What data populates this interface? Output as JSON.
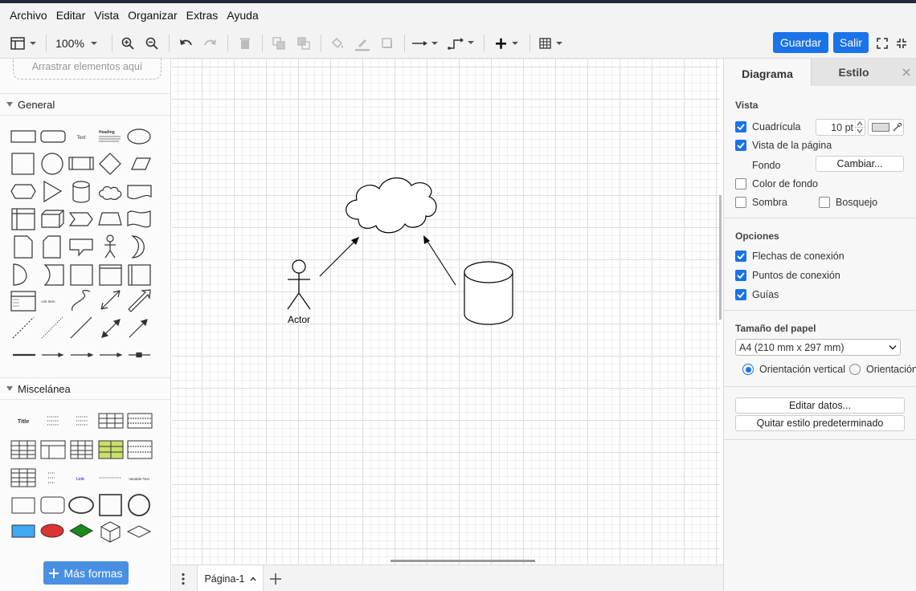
{
  "menu": [
    "Archivo",
    "Editar",
    "Vista",
    "Organizar",
    "Extras",
    "Ayuda"
  ],
  "toolbar": {
    "zoom": "100%",
    "save_label": "Guardar",
    "exit_label": "Salir"
  },
  "sidebar": {
    "drop_zone": "Arrastrar elementos aquí",
    "section_general": "General",
    "section_misc": "Miscelánea",
    "more_shapes": "Más formas",
    "shape_labels": {
      "text": "Text",
      "heading": "Heading",
      "title": "Title",
      "list_item": "List Item",
      "link": "Link",
      "variable": "Variable Text"
    }
  },
  "canvas": {
    "actor_label": "Actor"
  },
  "pages": {
    "current": "Página-1"
  },
  "panel": {
    "tab_diagram": "Diagrama",
    "tab_style": "Estilo",
    "view_title": "Vista",
    "grid_label": "Cuadrícula",
    "grid_size": "10 pt",
    "page_view_label": "Vista de la página",
    "background_label": "Fondo",
    "change_label": "Cambiar...",
    "bg_color_label": "Color de fondo",
    "shadow_label": "Sombra",
    "sketch_label": "Bosquejo",
    "options_title": "Opciones",
    "connection_arrows": "Flechas de conexión",
    "connection_points": "Puntos de conexión",
    "guides": "Guías",
    "paper_size_title": "Tamaño del papel",
    "paper_size_value": "A4 (210 mm x 297 mm)",
    "orientation_portrait": "Orientación vertical",
    "orientation_landscape": "Orientación",
    "edit_data": "Editar datos...",
    "clear_default_style": "Quitar estilo predeterminado"
  },
  "colors": {
    "accent": "#1a73e8",
    "more_shapes_button": "#4a90e2"
  }
}
